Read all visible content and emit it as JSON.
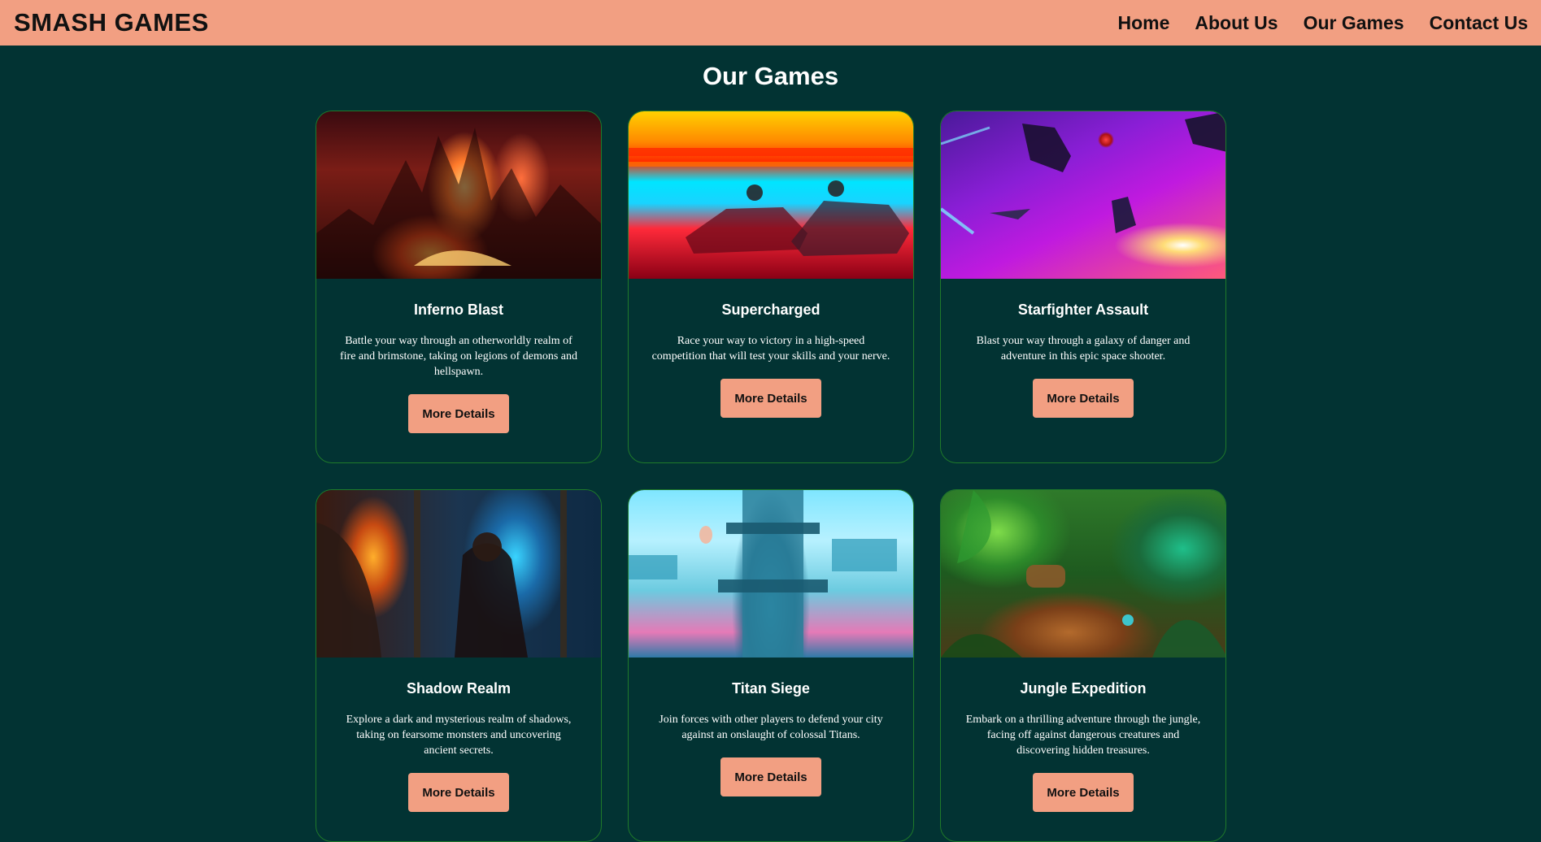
{
  "header": {
    "brand": "SMASH GAMES",
    "nav": [
      {
        "label": "Home"
      },
      {
        "label": "About Us"
      },
      {
        "label": "Our Games"
      },
      {
        "label": "Contact Us"
      }
    ]
  },
  "main": {
    "title": "Our Games",
    "games": [
      {
        "title": "Inferno Blast",
        "description": "Battle your way through an otherworldly realm of fire and brimstone, taking on legions of demons and hellspawn.",
        "button": "More Details",
        "image": "inferno-artwork"
      },
      {
        "title": "Supercharged",
        "description": "Race your way to victory in a high-speed competition that will test your skills and your nerve.",
        "button": "More Details",
        "image": "racing-artwork"
      },
      {
        "title": "Starfighter Assault",
        "description": "Blast your way through a galaxy of danger and adventure in this epic space shooter.",
        "button": "More Details",
        "image": "space-artwork"
      },
      {
        "title": "Shadow Realm",
        "description": "Explore a dark and mysterious realm of shadows, taking on fearsome monsters and uncovering ancient secrets.",
        "button": "More Details",
        "image": "shadow-artwork"
      },
      {
        "title": "Titan Siege",
        "description": "Join forces with other players to defend your city against an onslaught of colossal Titans.",
        "button": "More Details",
        "image": "city-artwork"
      },
      {
        "title": "Jungle Expedition",
        "description": "Embark on a thrilling adventure through the jungle, facing off against dangerous creatures and discovering hidden treasures.",
        "button": "More Details",
        "image": "jungle-artwork"
      }
    ]
  },
  "colors": {
    "header_bg": "#f29f82",
    "page_bg": "#023333",
    "card_border": "#1f7a2a",
    "button_bg": "#f29f82"
  }
}
